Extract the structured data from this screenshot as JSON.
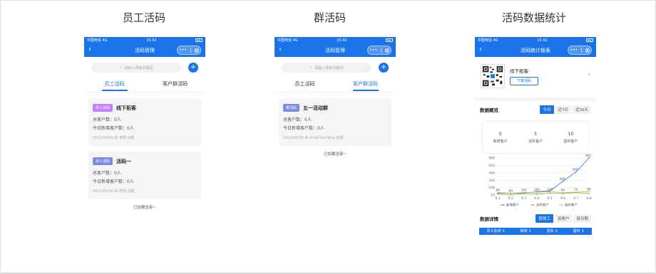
{
  "titles": {
    "employee": "员工活码",
    "group": "群活码",
    "stats": "活码数据统计"
  },
  "status": {
    "carrier": "中国电信  4G",
    "time": "15:42"
  },
  "phone1": {
    "nav_title": "活码管理",
    "search_placeholder": "请输入搜索关键词",
    "tabs": [
      "员工活码",
      "客户群活码"
    ],
    "cards": [
      {
        "badge": "单人活码",
        "badge_color": "#c77dff",
        "name": "线下拓客",
        "total": "总客户数：0人",
        "today": "今日新增客户数：0人",
        "meta": "2022/04/26    由 李明 创建"
      },
      {
        "badge": "多人活码",
        "badge_color": "#7b8cde",
        "name": "活码一",
        "total": "总客户数：0人",
        "today": "今日新增客户数：0人",
        "meta": "2022/04/26    由 李明 创建"
      }
    ],
    "footer": "已加载全部~"
  },
  "phone2": {
    "nav_title": "活码管理",
    "search_placeholder": "请输入搜索关键词",
    "tabs": [
      "员工活码",
      "客户群活码"
    ],
    "cards": [
      {
        "badge": "群活码",
        "badge_color": "#7b8cde",
        "name": "五一活动群",
        "total": "总客户数：0人",
        "today": "今日新增客户数：0人",
        "meta": "2022/04/26    由 XingChenYang 创建"
      }
    ],
    "footer": "已加载全部~"
  },
  "phone3": {
    "nav_title": "活码统计报表",
    "code_name": "线下拓客",
    "download": "下载活码",
    "overview_title": "数据概览",
    "ranges": [
      "今日",
      "近7日",
      "近30天"
    ],
    "kpis": [
      {
        "value": "0",
        "label": "新增客户"
      },
      {
        "value": "5",
        "label": "流失客户"
      },
      {
        "value": "10",
        "label": "留存客户"
      }
    ],
    "detail_title": "数据详情",
    "detail_tabs": [
      "按员工",
      "按客户",
      "按日期"
    ],
    "table_headers": [
      "员工名称 ⇕",
      "新增 ⇕",
      "流失 ⇕",
      "留存 ⇕"
    ]
  },
  "colors": {
    "primary": "#1a73e8",
    "series_new": "#1a73e8",
    "series_lost": "#67c23a",
    "series_kept": "#e6a23c"
  },
  "chart_data": {
    "type": "line",
    "categories": [
      "9.1",
      "9.2",
      "9.3",
      "9.4",
      "9.5",
      "9.6",
      "9.7",
      "9.8"
    ],
    "yticks": [
      10,
      168,
      326,
      484,
      642,
      800
    ],
    "ylim": [
      10,
      800
    ],
    "series": [
      {
        "name": "新增客户",
        "values": [
          50,
          50,
          50,
          80,
          100,
          300,
          500,
          800
        ]
      },
      {
        "name": "流失客户",
        "values": [
          30,
          20,
          40,
          30,
          50,
          40,
          60,
          40
        ]
      },
      {
        "name": "留存客户",
        "values": [
          60,
          50,
          60,
          70,
          80,
          60,
          70,
          80
        ]
      }
    ],
    "data_labels": [
      "80",
      "60",
      "100",
      "100",
      "130",
      "60",
      "70",
      "80"
    ],
    "new_labels": [
      "",
      "",
      "",
      "",
      "",
      "300",
      "500",
      "800"
    ]
  }
}
